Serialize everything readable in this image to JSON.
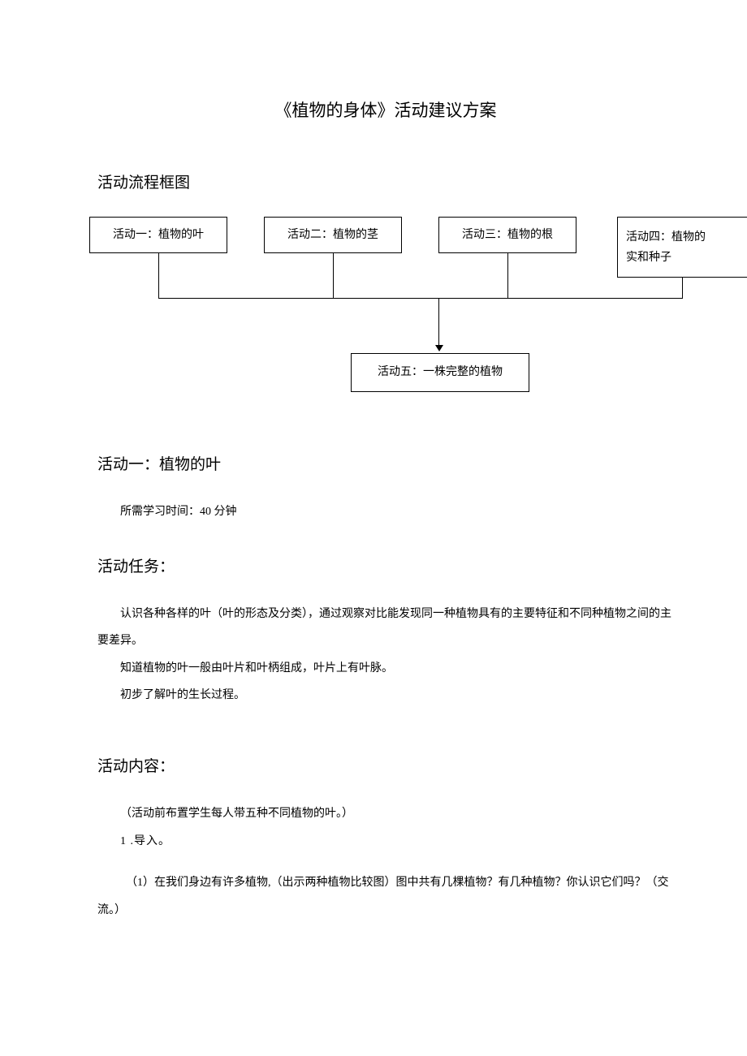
{
  "title": "《植物的身体》活动建议方案",
  "sections": {
    "flowchart_heading": "活动流程框图",
    "activity1_heading": "活动一：植物的叶",
    "task_heading": "活动任务：",
    "content_heading": "活动内容："
  },
  "flowchart": {
    "box1": "活动一：植物的叶",
    "box2": "活动二：植物的茎",
    "box3": "活动三：植物的根",
    "box4_line1": "活动四：植物的",
    "box4_line2": "实和种子",
    "box5": "活动五：一株完整的植物"
  },
  "activity1": {
    "time_label": "所需学习时间：40 分钟",
    "task_p1": "认识各种各样的叶（叶的形态及分类），通过观察对比能发现同一种植物具有的主要特征和不同种植物之间的主要差异。",
    "task_p2": "知道植物的叶一般由叶片和叶柄组成，叶片上有叶脉。",
    "task_p3": "初步了解叶的生长过程。",
    "content_pre": "（活动前布置学生每人带五种不同植物的叶。）",
    "content_item1_num": "1 .导入。",
    "content_item1_sub": "（1）在我们身边有许多植物,（出示两种植物比较图）图中共有几棵植物？有几种植物？你认识它们吗？（交流。）"
  }
}
